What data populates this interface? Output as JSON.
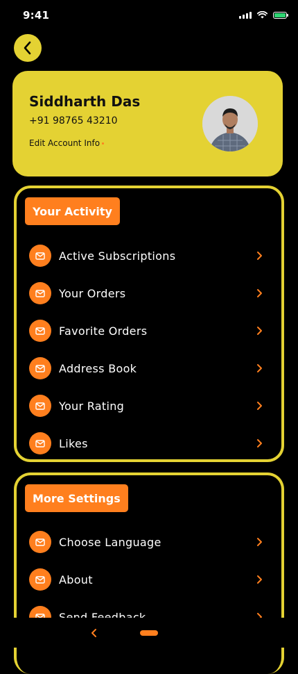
{
  "status_bar": {
    "time": "9:41"
  },
  "profile": {
    "name": "Siddharth Das",
    "phone": "+91 98765 43210",
    "edit_label": "Edit Account Info"
  },
  "activity": {
    "title": "Your Activity",
    "items": [
      {
        "label": "Active Subscriptions",
        "icon": "mail-icon"
      },
      {
        "label": "Your Orders",
        "icon": "mail-icon"
      },
      {
        "label": "Favorite Orders",
        "icon": "mail-icon"
      },
      {
        "label": "Address Book",
        "icon": "mail-icon"
      },
      {
        "label": "Your Rating",
        "icon": "mail-icon"
      },
      {
        "label": "Likes",
        "icon": "mail-icon"
      }
    ]
  },
  "settings": {
    "title": "More Settings",
    "items": [
      {
        "label": "Choose Language",
        "icon": "mail-icon"
      },
      {
        "label": "About",
        "icon": "mail-icon"
      },
      {
        "label": "Send Feedback",
        "icon": "mail-icon"
      }
    ]
  },
  "colors": {
    "accent_yellow": "#e4d233",
    "accent_orange": "#ff7f1e",
    "background": "#000000"
  }
}
